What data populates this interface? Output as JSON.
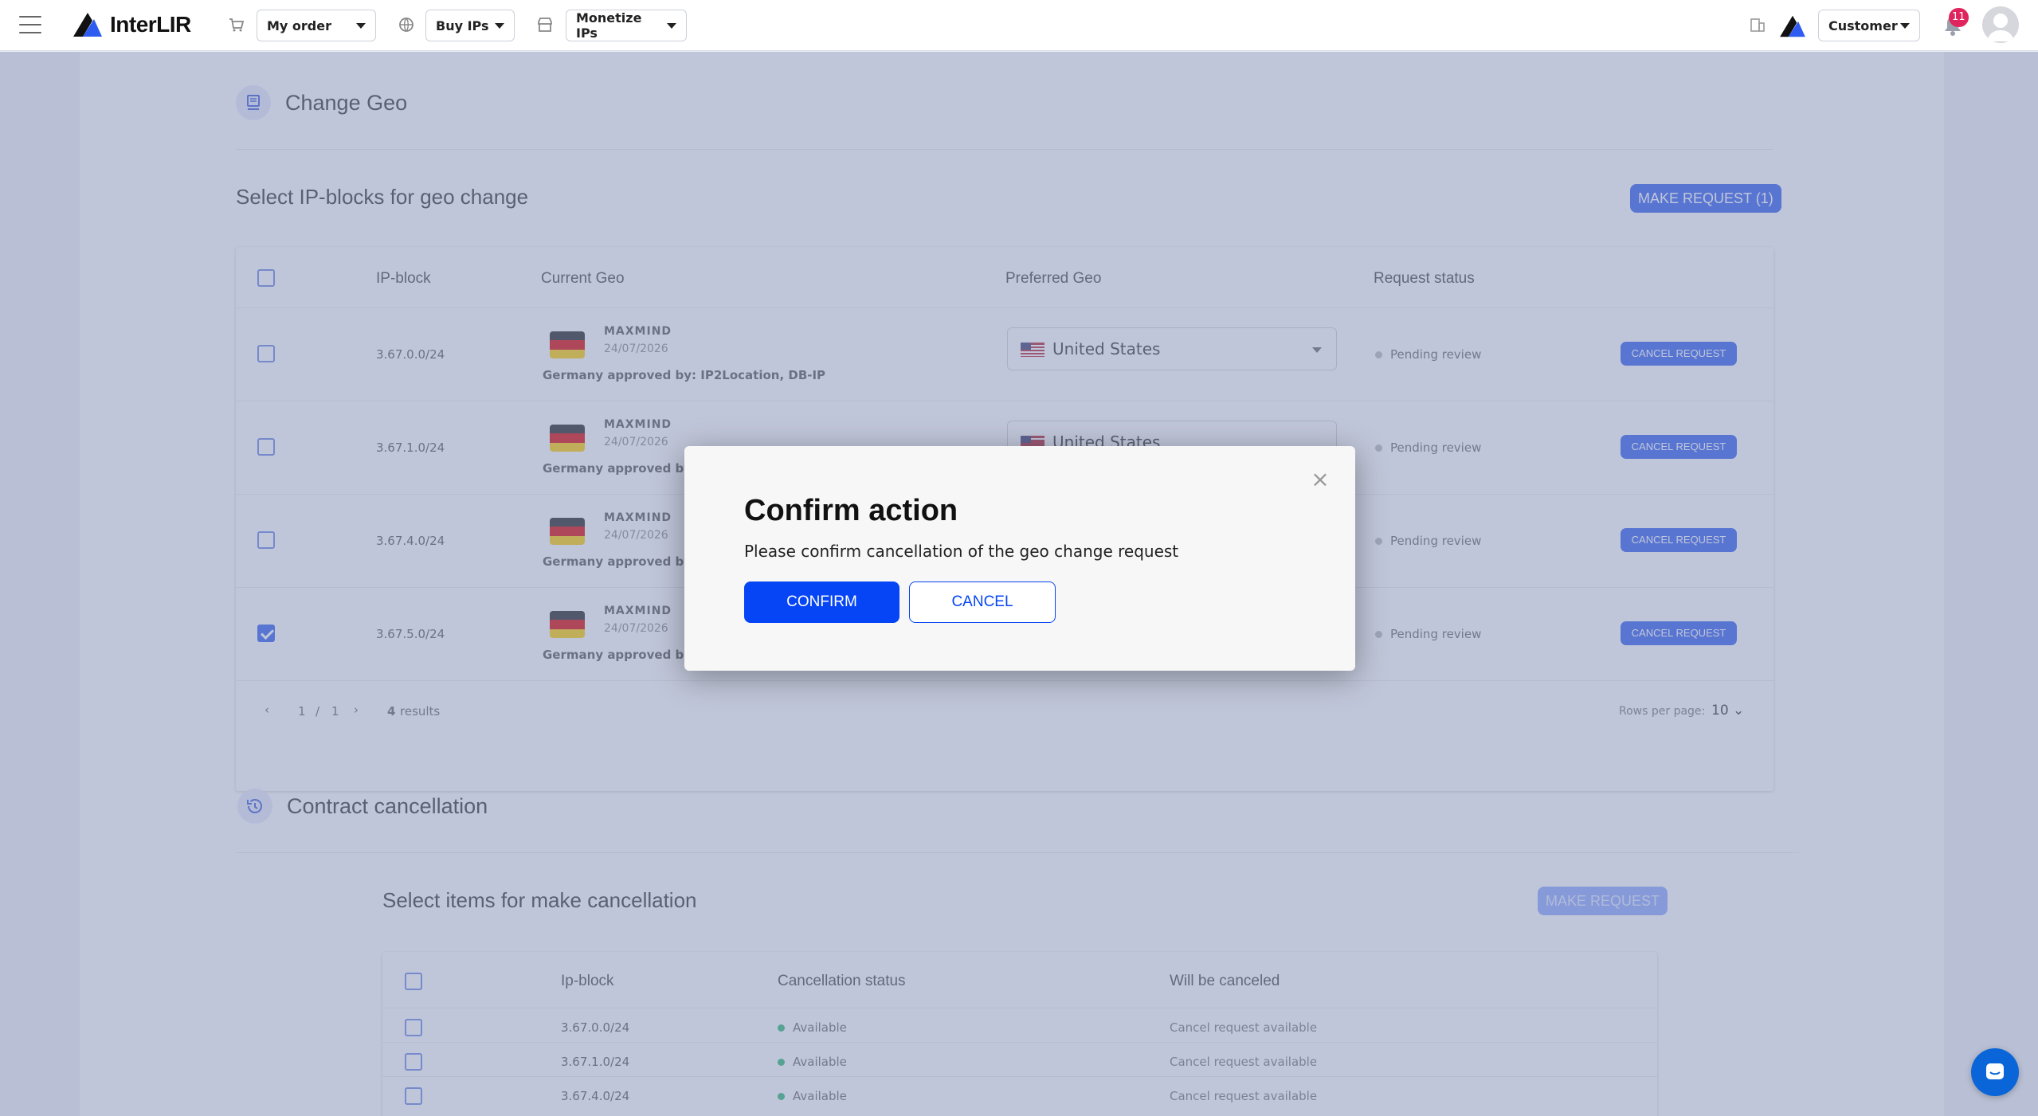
{
  "header": {
    "brand": "InterLIR",
    "menus": [
      {
        "label": "My order",
        "icon": "cart-icon"
      },
      {
        "label": "Buy IPs",
        "icon": "globe-icon"
      },
      {
        "label": "Monetize IPs",
        "icon": "store-icon"
      }
    ],
    "role_label": "Customer",
    "notifications_count": "11"
  },
  "geo_section": {
    "title": "Change Geo",
    "subtitle": "Select IP-blocks for geo change",
    "make_request_label": "MAKE REQUEST  (1)",
    "columns": [
      "IP-block",
      "Current Geo",
      "Preferred Geo",
      "Request status"
    ],
    "rows": [
      {
        "ip": "3.67.0.0/24",
        "source": "MAXMIND",
        "date": "24/07/2026",
        "approved": "Germany approved by: IP2Location, DB-IP",
        "preferred": "United States",
        "status": "Pending review",
        "action": "CANCEL REQUEST",
        "checked": false
      },
      {
        "ip": "3.67.1.0/24",
        "source": "MAXMIND",
        "date": "24/07/2026",
        "approved": "Germany approved by: I",
        "preferred": "United States",
        "status": "Pending review",
        "action": "CANCEL REQUEST",
        "checked": false
      },
      {
        "ip": "3.67.4.0/24",
        "source": "MAXMIND",
        "date": "24/07/2026",
        "approved": "Germany approved by: I",
        "preferred": "",
        "status": "Pending review",
        "action": "CANCEL REQUEST",
        "checked": false
      },
      {
        "ip": "3.67.5.0/24",
        "source": "MAXMIND",
        "date": "24/07/2026",
        "approved": "Germany approved by: I",
        "preferred": "",
        "status": "Pending review",
        "action": "CANCEL REQUEST",
        "checked": true
      }
    ],
    "pager": {
      "page": "1",
      "sep": "/",
      "total": "1",
      "results_count": "4",
      "results_label": "results",
      "rows_per_page_label": "Rows per page:",
      "rows_per_page": "10"
    }
  },
  "cancel_section": {
    "title": "Contract cancellation",
    "subtitle": "Select items for make cancellation",
    "make_request_label": "MAKE REQUEST",
    "columns": [
      "Ip-block",
      "Cancellation status",
      "Will be canceled"
    ],
    "rows": [
      {
        "ip": "3.67.0.0/24",
        "status": "Available",
        "will": "Cancel request available"
      },
      {
        "ip": "3.67.1.0/24",
        "status": "Available",
        "will": "Cancel request available"
      },
      {
        "ip": "3.67.4.0/24",
        "status": "Available",
        "will": "Cancel request available"
      }
    ]
  },
  "modal": {
    "title": "Confirm action",
    "message": "Please confirm cancellation of the geo change request",
    "confirm_label": "CONFIRM",
    "cancel_label": "CANCEL"
  },
  "colors": {
    "primary": "#0645f5",
    "accent": "#2f5cf0",
    "badge": "#e0245e",
    "available": "#2bb673"
  }
}
